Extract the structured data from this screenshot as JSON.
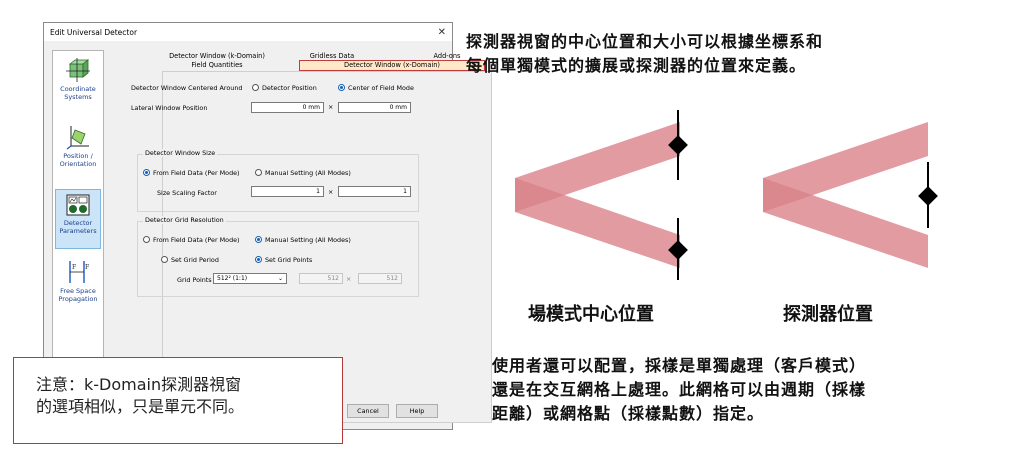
{
  "dialog": {
    "title": "Edit Universal Detector",
    "close_glyph": "✕",
    "sidebar": [
      {
        "label1": "Coordinate",
        "label2": "Systems",
        "icon": "coordinate-cube-icon"
      },
      {
        "label1": "Position /",
        "label2": "Orientation",
        "icon": "position-orientation-icon"
      },
      {
        "label1": "Detector",
        "label2": "Parameters",
        "icon": "detector-icon"
      },
      {
        "label1": "Free Space",
        "label2": "Propagation",
        "icon": "free-space-icon"
      }
    ],
    "tabs": {
      "row1": [
        "Detector Window (k-Domain)",
        "Gridless Data",
        "Add-ons"
      ],
      "row2": [
        "Field Quantities",
        "Detector Window (x-Domain)"
      ]
    },
    "centered_label": "Detector Window Centered Around",
    "centered_options": [
      "Detector Position",
      "Center of Field Mode"
    ],
    "lateral_label": "Lateral Window Position",
    "lateral_x": "0 mm",
    "lateral_y": "0 mm",
    "times": "×",
    "size_group": "Detector Window Size",
    "size_options": [
      "From Field Data (Per Mode)",
      "Manual Setting (All Modes)"
    ],
    "scaling_label": "Size Scaling Factor",
    "scaling_x": "1",
    "scaling_y": "1",
    "grid_group": "Detector Grid Resolution",
    "grid_options": [
      "From Field Data (Per Mode)",
      "Manual Setting (All Modes)"
    ],
    "grid_sub_options": [
      "Set Grid Period",
      "Set Grid Points"
    ],
    "grid_points_label": "Grid Points",
    "grid_points_select": "512² (1:1)",
    "grid_points_x": "512",
    "grid_points_y": "512",
    "cancel": "Cancel",
    "help": "Help"
  },
  "note": {
    "line1": "注意：k-Domain探測器視窗",
    "line2": "的選項相似，只是單元不同。"
  },
  "top_text": {
    "line1": "探測器視窗的中心位置和大小可以根據坐標系和",
    "line2": "每個單獨模式的擴展或探測器的位置來定義。"
  },
  "captions": {
    "left": "場模式中心位置",
    "right": "探測器位置"
  },
  "bottom_text": {
    "line1": "使用者還可以配置，採樣是單獨處理（客戶模式）",
    "line2": "還是在交互網格上處理。此網格可以由週期（採樣",
    "line3": "距離）或網格點（採樣點數）指定。"
  },
  "colors": {
    "beam": "#d9828a",
    "beam_overlap": "#c96a73",
    "highlight_tab": "#ffe9c8",
    "note_border": "#b33a3a"
  }
}
